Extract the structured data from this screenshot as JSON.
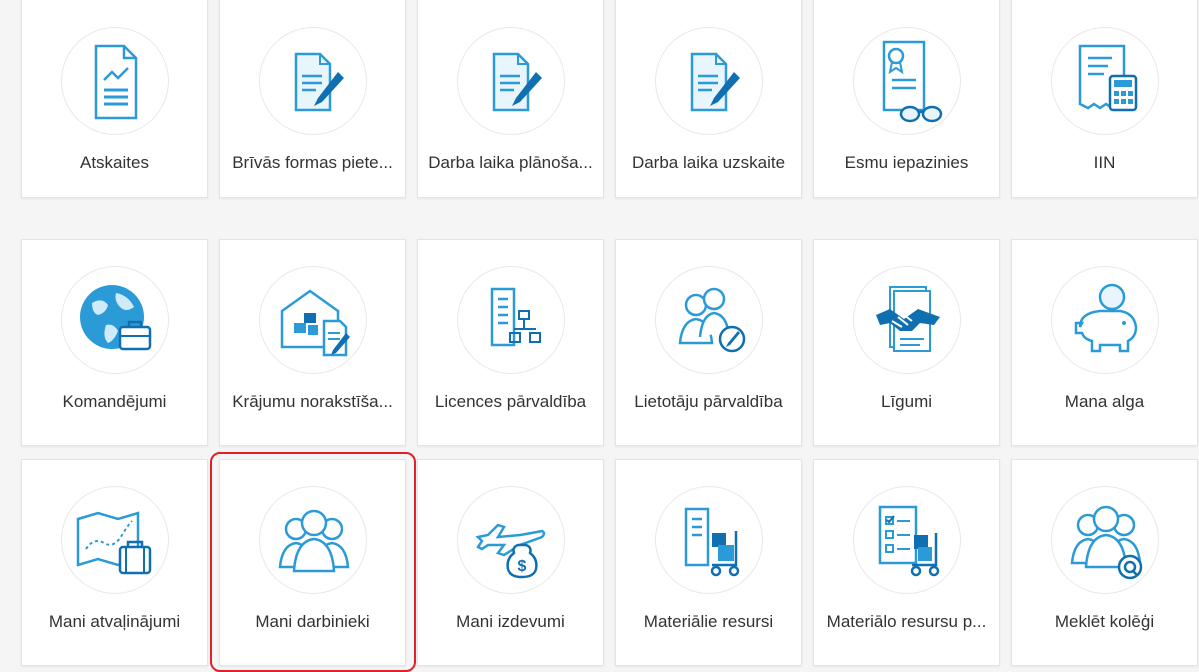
{
  "colors": {
    "icon_blue": "#2b9bd8",
    "icon_dark": "#0f6fb0",
    "highlight": "#e0202a"
  },
  "tiles": [
    {
      "label": "Atskaites",
      "icon": "report-chart-icon"
    },
    {
      "label": "Brīvās formas piete...",
      "icon": "document-pen-icon"
    },
    {
      "label": "Darba laika plānoša...",
      "icon": "document-pen-icon"
    },
    {
      "label": "Darba laika uzskaite",
      "icon": "document-pen-icon"
    },
    {
      "label": "Esmu iepazinies",
      "icon": "certificate-glasses-icon"
    },
    {
      "label": "IIN",
      "icon": "receipt-calculator-icon"
    },
    {
      "label": "Komandējumi",
      "icon": "globe-briefcase-icon"
    },
    {
      "label": "Krājumu norakstīša...",
      "icon": "warehouse-document-icon"
    },
    {
      "label": "Licences pārvaldība",
      "icon": "building-hierarchy-icon"
    },
    {
      "label": "Lietotāju pārvaldība",
      "icon": "users-edit-icon"
    },
    {
      "label": "Līgumi",
      "icon": "handshake-documents-icon"
    },
    {
      "label": "Mana alga",
      "icon": "piggy-bank-icon"
    },
    {
      "label": "Mani atvaļinājumi",
      "icon": "map-suitcase-icon"
    },
    {
      "label": "Mani darbinieki",
      "icon": "users-group-icon"
    },
    {
      "label": "Mani izdevumi",
      "icon": "plane-moneybag-icon"
    },
    {
      "label": "Materiālie resursi",
      "icon": "building-cart-icon"
    },
    {
      "label": "Materiālo resursu p...",
      "icon": "checklist-cart-icon"
    },
    {
      "label": "Meklēt kolēģi",
      "icon": "users-search-icon"
    }
  ]
}
